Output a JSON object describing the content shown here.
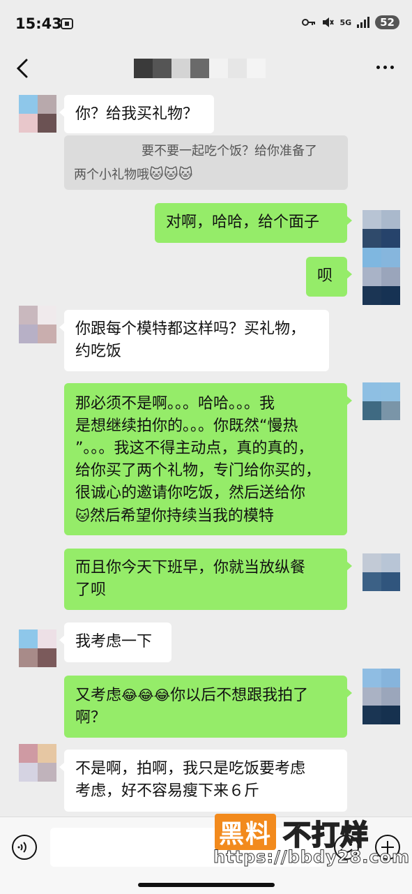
{
  "status_bar": {
    "time": "15:43",
    "network": "5G",
    "battery": "52"
  },
  "nav": {
    "title": ""
  },
  "messages": [
    {
      "side": "left",
      "text": "你？给我买礼物？"
    },
    {
      "side": "quote",
      "text": "要不要一起吃个饭？给你准备了",
      "text2": "两个小礼物哦"
    },
    {
      "side": "right",
      "text": "对啊，哈哈，给个面子"
    },
    {
      "side": "right",
      "text": "呗"
    },
    {
      "side": "left",
      "line1": "你跟每个模特都这样吗？买礼物，",
      "line2": "约吃饭"
    },
    {
      "side": "right",
      "line1": "那必须不是啊。。。哈哈。。。我",
      "line2": "是想继续拍你的。。。你既然“慢热",
      "line3": "”。。。我这不得主动点，真的真的，",
      "line4": "给你买了两个礼物，专门给你买的，",
      "line5": "很诚心的邀请你吃饭，然后送给你",
      "line6": "然后希望你持续当我的模特"
    },
    {
      "side": "right",
      "line1": "而且你今天下班早，你就当放纵餐",
      "line2": "了呗"
    },
    {
      "side": "left",
      "text": "我考虑一下"
    },
    {
      "side": "right",
      "line1a": "又考虑",
      "line1b": "你以后不想跟我拍了",
      "line2": "啊？"
    },
    {
      "side": "left",
      "line1": "不是啊，拍啊，我只是吃饭要考虑",
      "line2": "考虑，好不容易瘦下来６斤"
    }
  ],
  "emojis": {
    "cat": "🐱",
    "laugh_cry": "😂"
  },
  "watermark": {
    "brand": "黑料",
    "slogan": "不打烊",
    "url": "https://bbdy28.com"
  },
  "colors": {
    "bubble_self": "#95ec69",
    "bubble_other": "#ffffff",
    "background": "#ededed"
  }
}
